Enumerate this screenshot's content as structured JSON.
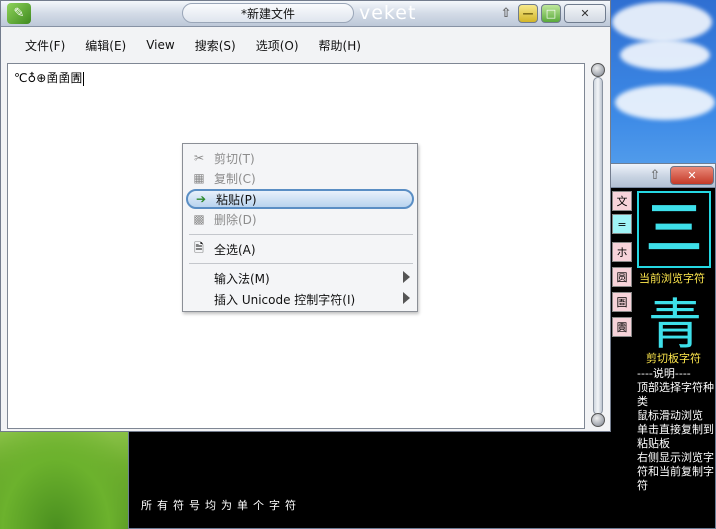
{
  "editor_window": {
    "title": "*新建文件",
    "brand": "veket",
    "menus": [
      "文件(F)",
      "编辑(E)",
      "View",
      "搜索(S)",
      "选项(O)",
      "帮助(H)"
    ],
    "content": "℃♁⊕圅圅圊"
  },
  "context_menu": {
    "items": [
      {
        "label": "剪切(T)",
        "icon": "scissors-icon",
        "glyph": "✂",
        "enabled": false
      },
      {
        "label": "复制(C)",
        "icon": "copy-icon",
        "glyph": "▦",
        "enabled": false
      },
      {
        "label": "粘贴(P)",
        "icon": "paste-icon",
        "glyph": "➔",
        "enabled": true,
        "highlighted": true
      },
      {
        "label": "删除(D)",
        "icon": "delete-icon",
        "glyph": "▩",
        "enabled": false
      },
      {
        "label": "全选(A)",
        "icon": "select-all-icon",
        "glyph": "🗎",
        "enabled": true
      },
      {
        "label": "输入法(M)",
        "submenu": true,
        "enabled": true
      },
      {
        "label": "插入 Unicode 控制字符(I)",
        "submenu": true,
        "enabled": true
      }
    ]
  },
  "char_window": {
    "categories": [
      "文",
      "=",
      "ホ",
      "圆",
      "圄",
      "圚"
    ],
    "preview_char": "三",
    "preview_label": "当前浏览字符",
    "clipboard_char": "青",
    "clipboard_label": "剪切板字符",
    "help_lines": [
      "----说明----",
      "  顶部选择字符种类",
      "  鼠标滑动浏览",
      "  单击直接复制到粘贴板",
      "  右侧显示浏览字符和当前复制字符"
    ],
    "status": "所有符号均为单个字符"
  }
}
